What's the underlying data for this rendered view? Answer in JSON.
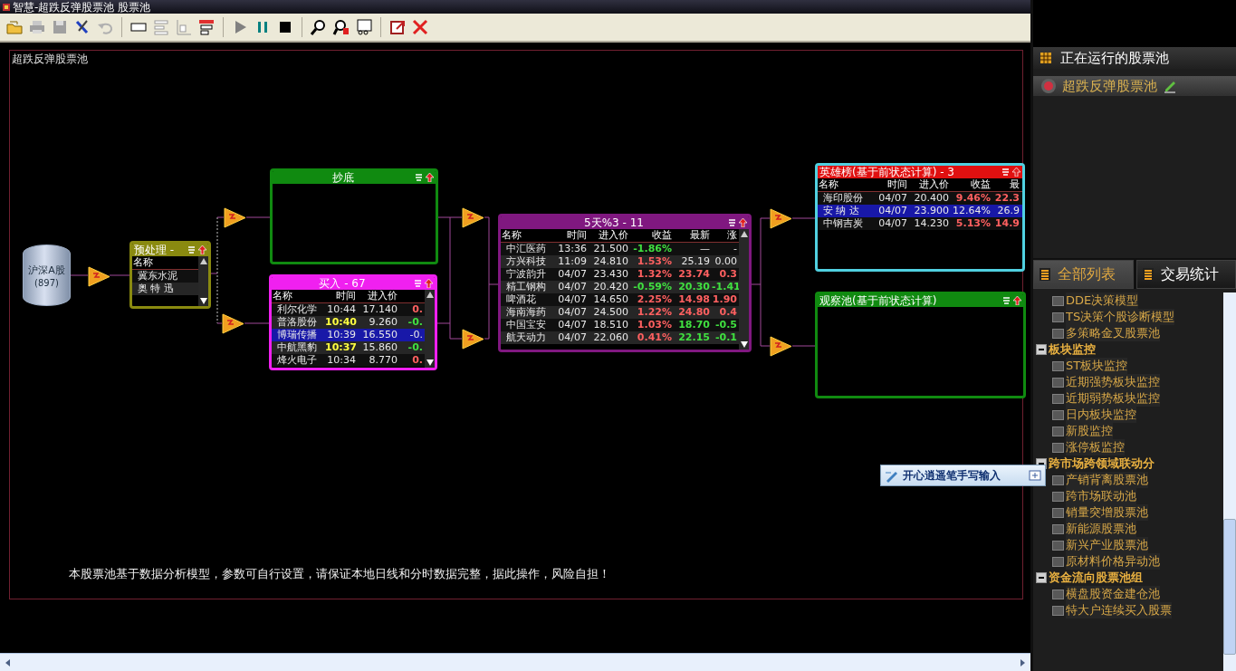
{
  "window": {
    "title": "智慧-超跌反弹股票池  股票池"
  },
  "canvas": {
    "label": "超跌反弹股票池",
    "footer": "本股票池基于数据分析模型，参数可自行设置，请保证本地日线和分时数据完整，据此操作，风险自担！"
  },
  "source": {
    "name": "沪深A股",
    "count": "(897)"
  },
  "pools": [
    {
      "title": "预处理 -",
      "color": "#8a8a10",
      "scrollable": true,
      "columns": [
        "名称"
      ],
      "rows": [
        {
          "cells": [
            {
              "text": "冀东水泥"
            }
          ],
          "selected": false
        },
        {
          "cells": [
            {
              "text": "奥 特 迅"
            }
          ],
          "selected": false
        }
      ]
    },
    {
      "title": "抄底",
      "color": "#108a10",
      "scrollable": false
    },
    {
      "title": "买入 - 67",
      "color": "#f020f0",
      "scrollable": true,
      "columns": [
        "名称",
        "时间",
        "进入价"
      ],
      "rows": [
        {
          "cells": [
            {
              "text": "利尔化学"
            },
            {
              "text": "10:44"
            },
            {
              "text": "17.140"
            },
            {
              "text": "0.",
              "color": "#ff6060"
            }
          ],
          "selected": false
        },
        {
          "cells": [
            {
              "text": "普洛股份"
            },
            {
              "text": "10:40",
              "color": "#ffff40"
            },
            {
              "text": "9.260"
            },
            {
              "text": "-0.",
              "color": "#40e040"
            }
          ],
          "selected": false
        },
        {
          "cells": [
            {
              "text": "博瑞传播"
            },
            {
              "text": "10:39"
            },
            {
              "text": "16.550"
            },
            {
              "text": "-0."
            }
          ],
          "selected": true
        },
        {
          "cells": [
            {
              "text": "中航黑豹"
            },
            {
              "text": "10:37",
              "color": "#ffff40"
            },
            {
              "text": "15.860"
            },
            {
              "text": "-0.",
              "color": "#40e040"
            }
          ],
          "selected": false
        },
        {
          "cells": [
            {
              "text": "烽火电子"
            },
            {
              "text": "10:34"
            },
            {
              "text": "8.770"
            },
            {
              "text": "0.",
              "color": "#ff6060"
            }
          ],
          "selected": false
        }
      ]
    },
    {
      "title": "5天%3 - 11",
      "color": "#801880",
      "scrollable": true,
      "columns": [
        "名称",
        "时间",
        "进入价",
        "收益",
        "最新",
        "涨"
      ],
      "rows": [
        {
          "cells": [
            {
              "text": "中汇医药"
            },
            {
              "text": "13:36"
            },
            {
              "text": "21.500"
            },
            {
              "text": "-1.86%",
              "color": "#40e040"
            },
            {
              "text": "—"
            },
            {
              "text": "-"
            }
          ],
          "selected": false
        },
        {
          "cells": [
            {
              "text": "方兴科技"
            },
            {
              "text": "11:09"
            },
            {
              "text": "24.810"
            },
            {
              "text": "1.53%",
              "color": "#ff6060"
            },
            {
              "text": "25.19"
            },
            {
              "text": "0.00"
            }
          ],
          "selected": false
        },
        {
          "cells": [
            {
              "text": "宁波韵升"
            },
            {
              "text": "04/07"
            },
            {
              "text": "23.430"
            },
            {
              "text": "1.32%",
              "color": "#ff6060"
            },
            {
              "text": "23.74",
              "color": "#ff6060"
            },
            {
              "text": "0.3",
              "color": "#ff6060"
            }
          ],
          "selected": false
        },
        {
          "cells": [
            {
              "text": "精工钢构"
            },
            {
              "text": "04/07"
            },
            {
              "text": "20.420"
            },
            {
              "text": "-0.59%",
              "color": "#40e040"
            },
            {
              "text": "20.30",
              "color": "#40e040"
            },
            {
              "text": "-1.41",
              "color": "#40e040"
            }
          ],
          "selected": false
        },
        {
          "cells": [
            {
              "text": "啤酒花"
            },
            {
              "text": "04/07"
            },
            {
              "text": "14.650"
            },
            {
              "text": "2.25%",
              "color": "#ff6060"
            },
            {
              "text": "14.98",
              "color": "#ff6060"
            },
            {
              "text": "1.90",
              "color": "#ff6060"
            }
          ],
          "selected": false
        },
        {
          "cells": [
            {
              "text": "海南海药"
            },
            {
              "text": "04/07"
            },
            {
              "text": "24.500"
            },
            {
              "text": "1.22%",
              "color": "#ff6060"
            },
            {
              "text": "24.80",
              "color": "#ff6060"
            },
            {
              "text": "0.4",
              "color": "#ff6060"
            }
          ],
          "selected": false
        },
        {
          "cells": [
            {
              "text": "中国宝安"
            },
            {
              "text": "04/07"
            },
            {
              "text": "18.510"
            },
            {
              "text": "1.03%",
              "color": "#ff6060"
            },
            {
              "text": "18.70",
              "color": "#40e040"
            },
            {
              "text": "-0.5",
              "color": "#40e040"
            }
          ],
          "selected": false
        },
        {
          "cells": [
            {
              "text": "航天动力"
            },
            {
              "text": "04/07"
            },
            {
              "text": "22.060"
            },
            {
              "text": "0.41%",
              "color": "#ff6060"
            },
            {
              "text": "22.15",
              "color": "#40e040"
            },
            {
              "text": "-0.1",
              "color": "#40e040"
            }
          ],
          "selected": false
        }
      ]
    },
    {
      "title": "英雄榜(基于前状态计算) - 3",
      "color": "#50d0e0",
      "header": {
        "color": "#e01010"
      },
      "scrollable": false,
      "columns": [
        "名称",
        "时间",
        "进入价",
        "收益",
        "最"
      ],
      "rows": [
        {
          "cells": [
            {
              "text": "海印股份"
            },
            {
              "text": "04/07"
            },
            {
              "text": "20.400"
            },
            {
              "text": "9.46%",
              "color": "#ff6060"
            },
            {
              "text": "22.3",
              "color": "#ff6060"
            }
          ],
          "selected": false
        },
        {
          "cells": [
            {
              "text": "安 纳 达"
            },
            {
              "text": "04/07"
            },
            {
              "text": "23.900"
            },
            {
              "text": "12.64%"
            },
            {
              "text": "26.9"
            }
          ],
          "selected": true
        },
        {
          "cells": [
            {
              "text": "中钢吉炭"
            },
            {
              "text": "04/07"
            },
            {
              "text": "14.230"
            },
            {
              "text": "5.13%",
              "color": "#ff6060"
            },
            {
              "text": "14.9",
              "color": "#ff6060"
            }
          ],
          "selected": false
        }
      ]
    },
    {
      "title": "观察池(基于前状态计算)",
      "color": "#108a10",
      "scrollable": false
    }
  ],
  "ime_bar": {
    "label": "开心逍遥笔手写输入"
  },
  "sidebar": {
    "running_header": "正在运行的股票池",
    "running_pool": "超跌反弹股票池",
    "tabs": [
      {
        "label": "全部列表",
        "selected": true
      },
      {
        "label": "交易统计",
        "selected": false
      }
    ],
    "tree": [
      {
        "children": [
          {
            "label": "DDE决策模型"
          },
          {
            "label": "TS决策个股诊断模型"
          },
          {
            "label": "多策略金叉股票池"
          }
        ]
      },
      {
        "label": "板块监控",
        "expanded": true,
        "children": [
          {
            "label": "ST板块监控"
          },
          {
            "label": "近期强势板块监控"
          },
          {
            "label": "近期弱势板块监控"
          },
          {
            "label": "日内板块监控"
          },
          {
            "label": "新股监控"
          },
          {
            "label": "涨停板监控"
          }
        ]
      },
      {
        "label": "跨市场跨领域联动分",
        "expanded": true,
        "children": [
          {
            "label": "产销背离股票池"
          },
          {
            "label": "跨市场联动池"
          },
          {
            "label": "销量突增股票池"
          },
          {
            "label": "新能源股票池"
          },
          {
            "label": "新兴产业股票池"
          },
          {
            "label": "原材料价格异动池"
          }
        ]
      },
      {
        "label": "资金流向股票池组",
        "expanded": true,
        "children": [
          {
            "label": "横盘股资金建仓池"
          },
          {
            "label": "特大户连续买入股票"
          }
        ]
      }
    ]
  }
}
